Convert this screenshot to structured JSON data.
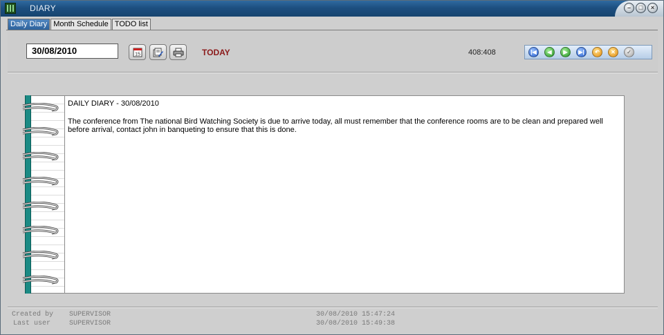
{
  "window": {
    "title": "DIARY"
  },
  "tabs": [
    {
      "label": "Daily Diary",
      "active": true
    },
    {
      "label": "Month Schedule",
      "active": false
    },
    {
      "label": "TODO list",
      "active": false
    }
  ],
  "toolbar": {
    "date_value": "30/08/2010",
    "today_label": "TODAY",
    "counter": "408:408",
    "buttons": [
      "calendar-icon",
      "edit-icon",
      "print-icon"
    ],
    "nav_buttons": [
      "first-icon",
      "previous-icon",
      "next-icon",
      "last-icon",
      "undo-icon",
      "cancel-icon",
      "confirm-icon"
    ]
  },
  "diary": {
    "heading": "DAILY DIARY - 30/08/2010",
    "text": "The conference from The national Bird Watching Society is due to arrive today, all must remember that the conference rooms are to be clean and prepared well before arrival, contact john in banqueting to ensure that this is done."
  },
  "footer": {
    "created_by_label": "Created by",
    "created_by_value": "SUPERVISOR",
    "created_at": "30/08/2010 15:47:24",
    "last_user_label": "Last user",
    "last_user_value": "SUPERVISOR",
    "last_at": "30/08/2010 15:49:38"
  },
  "colors": {
    "title_bar": "#1d4f80",
    "tab_active": "#3a72ae",
    "today_text": "#8b1a1a",
    "spine": "#1a8a84"
  }
}
